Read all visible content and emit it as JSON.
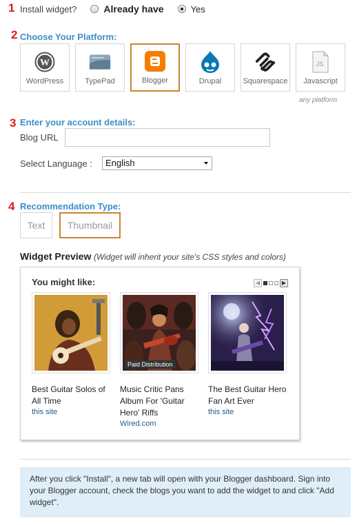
{
  "step1": {
    "number": "1",
    "question": "Install widget?",
    "options": [
      {
        "label": "Already have",
        "checked": false
      },
      {
        "label": "Yes",
        "checked": true
      }
    ]
  },
  "step2": {
    "number": "2",
    "title": "Choose Your Platform:",
    "platforms": [
      {
        "label": "WordPress",
        "icon": "wordpress-icon",
        "selected": false
      },
      {
        "label": "TypePad",
        "icon": "typepad-icon",
        "selected": false
      },
      {
        "label": "Blogger",
        "icon": "blogger-icon",
        "selected": true
      },
      {
        "label": "Drupal",
        "icon": "drupal-icon",
        "selected": false
      },
      {
        "label": "Squarespace",
        "icon": "squarespace-icon",
        "selected": false
      },
      {
        "label": "Javascript",
        "icon": "javascript-icon",
        "selected": false
      }
    ],
    "any_platform_note": "any platform"
  },
  "step3": {
    "number": "3",
    "title": "Enter your account details:",
    "blog_url_label": "Blog URL",
    "blog_url_value": "",
    "language_label": "Select Language :",
    "language_value": "English"
  },
  "step4": {
    "number": "4",
    "title": "Recommendation Type:",
    "types": [
      {
        "label": "Text",
        "selected": false
      },
      {
        "label": "Thumbnail",
        "selected": true
      }
    ]
  },
  "preview": {
    "heading": "Widget Preview",
    "note": "(Widget will inherit your site's CSS styles and colors)",
    "widget_title": "You might like:",
    "cards": [
      {
        "title": "Best Guitar Solos of All Time",
        "source": "this site",
        "badge": ""
      },
      {
        "title": "Music Critic Pans Album For 'Guitar Hero' Riffs",
        "source": "Wired.com",
        "badge": "Paid Distribution"
      },
      {
        "title": "The Best Guitar Hero Fan Art Ever",
        "source": "this site",
        "badge": ""
      }
    ]
  },
  "info": {
    "text": "After you click \"Install\", a new tab will open with your Blogger dashboard. Sign into your Blogger account, check the blogs you want to add the widget to and click \"Add widget\"."
  },
  "colors": {
    "step_number": "#e01a1a",
    "section_title": "#3a8fc7",
    "selected_border": "#c9852f",
    "blogger_orange": "#f57d00",
    "info_bg": "#dfeef8"
  }
}
